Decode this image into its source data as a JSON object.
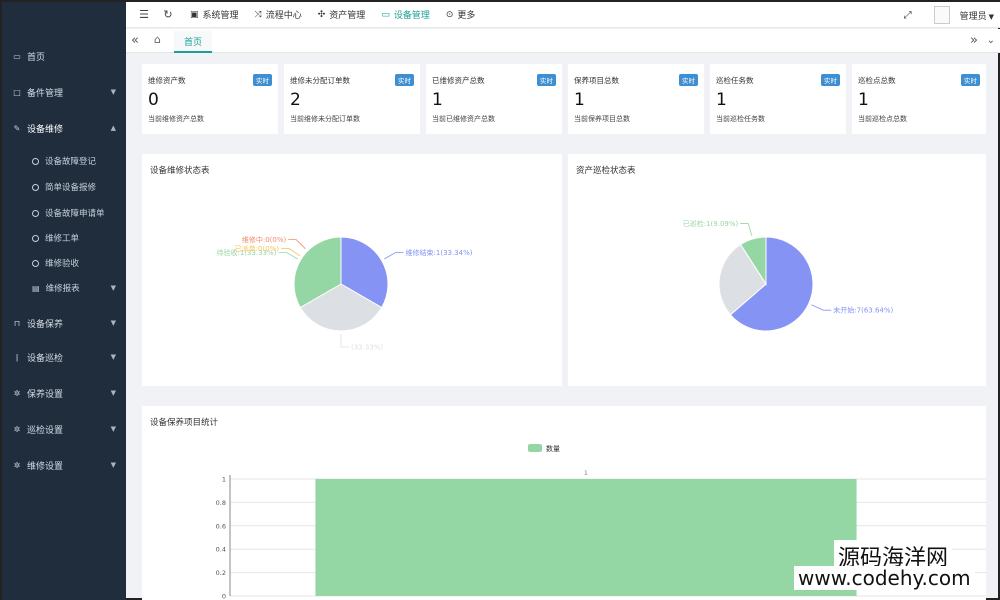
{
  "sidebar": {
    "items": [
      {
        "label": "首页",
        "icon": "monitor-icon"
      },
      {
        "label": "备件管理",
        "icon": "box-icon"
      },
      {
        "label": "设备维修",
        "icon": "wrench-icon"
      },
      {
        "label": "设备保养",
        "icon": "bookmark-icon"
      },
      {
        "label": "设备巡检",
        "icon": "info-icon"
      },
      {
        "label": "保养设置",
        "icon": "gear-icon"
      },
      {
        "label": "巡检设置",
        "icon": "gear-icon"
      },
      {
        "label": "维修设置",
        "icon": "gear-icon"
      }
    ],
    "sub_items": [
      {
        "label": "设备故障登记"
      },
      {
        "label": "简单设备报修"
      },
      {
        "label": "设备故障申请单"
      },
      {
        "label": "维修工单"
      },
      {
        "label": "维修验收"
      },
      {
        "label": "维修报表"
      }
    ]
  },
  "topnav": {
    "items": [
      {
        "label": "系统管理",
        "icon": "system-icon"
      },
      {
        "label": "流程中心",
        "icon": "shuffle-icon"
      },
      {
        "label": "资产管理",
        "icon": "cogs-icon"
      },
      {
        "label": "设备管理",
        "icon": "desktop-icon"
      },
      {
        "label": "更多",
        "icon": "chevron-circle-icon"
      }
    ],
    "user": "管理员"
  },
  "tabs": {
    "home_label": "首页"
  },
  "accent_color": "#1aa094",
  "stats": [
    {
      "title": "维修资产数",
      "badge": "实时",
      "value": "0",
      "desc": "当前维修资产总数"
    },
    {
      "title": "维修未分配订单数",
      "badge": "实时",
      "value": "2",
      "desc": "当前维修未分配订单数"
    },
    {
      "title": "已维修资产总数",
      "badge": "实时",
      "value": "1",
      "desc": "当前已维修资产总数"
    },
    {
      "title": "保养项目总数",
      "badge": "实时",
      "value": "1",
      "desc": "当前保养项目总数"
    },
    {
      "title": "巡检任务数",
      "badge": "实时",
      "value": "1",
      "desc": "当前巡检任务数"
    },
    {
      "title": "巡检点总数",
      "badge": "实时",
      "value": "1",
      "desc": "当前巡检点总数"
    }
  ],
  "panels": {
    "repair_title": "设备维修状态表",
    "inspection_title": "资产巡检状态表",
    "maintenance_title": "设备保养项目统计"
  },
  "chart_data": [
    {
      "type": "pie",
      "title": "设备维修状态表",
      "series": [
        {
          "name": "维修结束",
          "value": 1,
          "label": "维修结束:1(33.34%)",
          "color": "#8593f4"
        },
        {
          "name": "",
          "value": 1,
          "label": "(33.33%)",
          "color": "#dcdfe3"
        },
        {
          "name": "待验收",
          "value": 1,
          "label": "待验收:1(33.33%)",
          "color": "#95d6a5"
        },
        {
          "name": "维修中",
          "value": 0,
          "label": "维修中:0(0%)",
          "color": "#f08c6a"
        },
        {
          "name": "已派单",
          "value": 0,
          "label": "已派单:0(0%)",
          "color": "#f5c657"
        }
      ]
    },
    {
      "type": "pie",
      "title": "资产巡检状态表",
      "series": [
        {
          "name": "未开始",
          "value": 7,
          "label": "未开始:7(63.64%)",
          "color": "#8593f4"
        },
        {
          "name": "",
          "value": 3,
          "label": "",
          "color": "#dcdfe3"
        },
        {
          "name": "已巡检",
          "value": 1,
          "label": "已巡检:1(9.09%)",
          "color": "#95d6a5"
        }
      ]
    },
    {
      "type": "bar",
      "title": "设备保养项目统计",
      "legend": "数量",
      "categories": [
        ""
      ],
      "values": [
        1
      ],
      "ylim": [
        0,
        1
      ],
      "yticks": [
        "0",
        "0.2",
        "0.4",
        "0.6",
        "0.8",
        "1"
      ],
      "value_label": "1",
      "color": "#95d6a5"
    }
  ],
  "watermark": {
    "line1": "源码海洋网",
    "line2": "www.codehy.com"
  }
}
